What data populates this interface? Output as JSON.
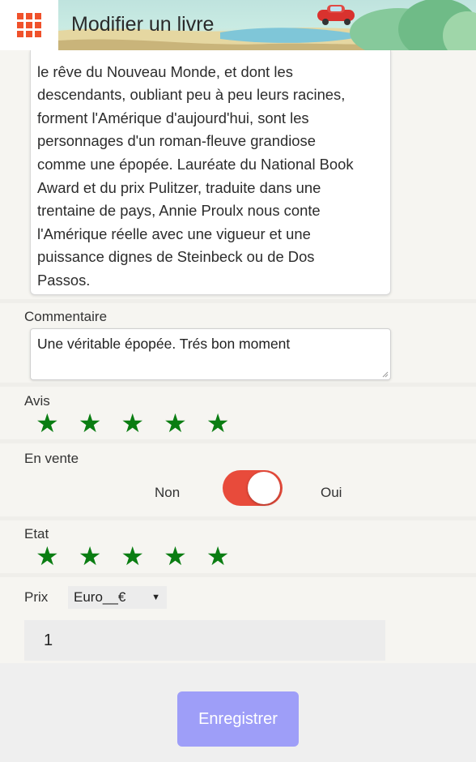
{
  "header": {
    "title": "Modifier un livre",
    "menu_icon": "grid-menu-icon",
    "accent_color": "#f0512b"
  },
  "description": {
    "lines": [
      "le rêve du Nouveau Monde, et dont les",
      "descendants, oubliant peu à peu leurs racines,",
      "forment l'Amérique d'aujourd'hui, sont les",
      "personnages d'un roman-fleuve grandiose",
      "comme une épopée. Lauréate du National Book",
      "Award et du prix Pulitzer, traduite dans une",
      "trentaine de pays, Annie Proulx nous conte",
      "l'Amérique réelle avec une vigueur et une",
      "puissance dignes de Steinbeck ou de Dos",
      "Passos."
    ]
  },
  "comment": {
    "label": "Commentaire",
    "value": "Une véritable épopée. Trés bon moment"
  },
  "avis": {
    "label": "Avis",
    "rating": 5,
    "max": 5,
    "star_color": "#0a7d12"
  },
  "sale": {
    "label": "En vente",
    "off_label": "Non",
    "on_label": "Oui",
    "enabled": true,
    "toggle_color": "#e84b3b"
  },
  "etat": {
    "label": "Etat",
    "rating": 5,
    "max": 5
  },
  "price": {
    "label": "Prix",
    "currency": "Euro__€",
    "value": "1"
  },
  "save": {
    "label": "Enregistrer",
    "color": "#9e9ef8"
  }
}
